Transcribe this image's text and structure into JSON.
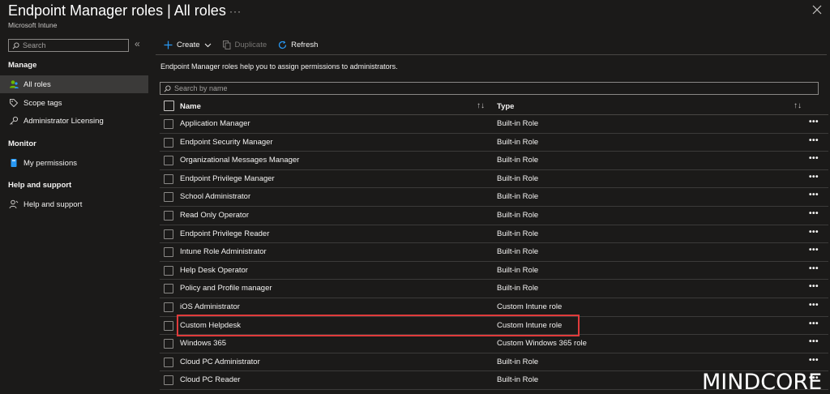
{
  "header": {
    "title": "Endpoint Manager roles | All roles",
    "subtitle": "Microsoft Intune",
    "more": "···"
  },
  "sidebar": {
    "search_placeholder": "Search",
    "collapse": "«",
    "sections": [
      {
        "label": "Manage"
      },
      {
        "label": "Monitor"
      },
      {
        "label": "Help and support"
      }
    ],
    "items": [
      {
        "label": "All roles",
        "icon": "users-icon",
        "active": true
      },
      {
        "label": "Scope tags",
        "icon": "tag-icon"
      },
      {
        "label": "Administrator Licensing",
        "icon": "key-icon"
      },
      {
        "label": "My permissions",
        "icon": "book-icon"
      },
      {
        "label": "Help and support",
        "icon": "person-help-icon"
      }
    ]
  },
  "toolbar": {
    "create_label": "Create",
    "duplicate_label": "Duplicate",
    "refresh_label": "Refresh"
  },
  "main": {
    "description": "Endpoint Manager roles help you to assign permissions to administrators.",
    "search_placeholder": "Search by name"
  },
  "table": {
    "columns": {
      "name": "Name",
      "type": "Type"
    },
    "rows": [
      {
        "name": "Application Manager",
        "type": "Built-in Role"
      },
      {
        "name": "Endpoint Security Manager",
        "type": "Built-in Role"
      },
      {
        "name": "Organizational Messages Manager",
        "type": "Built-in Role"
      },
      {
        "name": "Endpoint Privilege Manager",
        "type": "Built-in Role"
      },
      {
        "name": "School Administrator",
        "type": "Built-in Role"
      },
      {
        "name": "Read Only Operator",
        "type": "Built-in Role"
      },
      {
        "name": "Endpoint Privilege Reader",
        "type": "Built-in Role"
      },
      {
        "name": "Intune Role Administrator",
        "type": "Built-in Role"
      },
      {
        "name": "Help Desk Operator",
        "type": "Built-in Role"
      },
      {
        "name": "Policy and Profile manager",
        "type": "Built-in Role"
      },
      {
        "name": "iOS Administrator",
        "type": "Custom Intune role"
      },
      {
        "name": "Custom Helpdesk",
        "type": "Custom Intune role"
      },
      {
        "name": "Windows 365",
        "type": "Custom Windows 365 role"
      },
      {
        "name": "Cloud PC Administrator",
        "type": "Built-in Role"
      },
      {
        "name": "Cloud PC Reader",
        "type": "Built-in Role"
      }
    ],
    "row_more": "•••",
    "sort": "↑↓"
  },
  "watermark": "MINDCORE",
  "colors": {
    "background": "#1b1a19",
    "accent": "#2899f5",
    "highlight": "#e03b3b"
  }
}
